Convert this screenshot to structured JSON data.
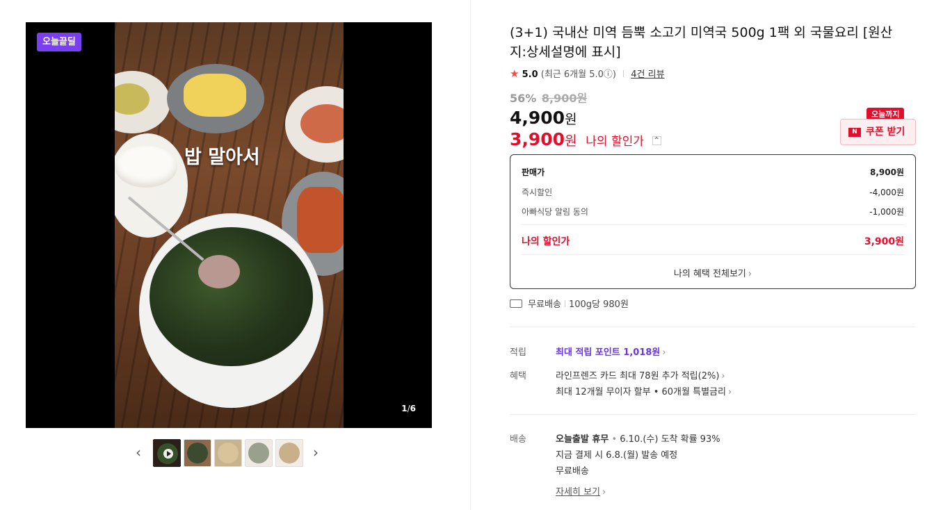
{
  "gallery": {
    "deal_badge": "오늘끝딜",
    "overlay_caption": "밥 말아서",
    "counter_current": "1",
    "counter_total": "6",
    "prev_arrow": "‹",
    "next_arrow": "›"
  },
  "product": {
    "title": "(3+1) 국내산 미역 듬뿍 소고기 미역국 500g 1팩 외 국물요리 [원산지:상세설명에 표시]",
    "rating": {
      "star": "★",
      "score": "5.0",
      "recent": "(최근 6개월 5.0ⓘ)",
      "reviews": "4건 리뷰"
    },
    "discount_rate": "56%",
    "original_price": "8,900원",
    "price": "4,900",
    "price_unit": "원",
    "my_price": "3,900",
    "my_price_unit": "원",
    "my_price_label": "나의 할인가",
    "my_price_caret": "^"
  },
  "coupon": {
    "tag": "오늘까지",
    "icon_text": "N",
    "label": "쿠폰 받기"
  },
  "breakdown": {
    "rows": [
      {
        "label": "판매가",
        "value": "8,900원"
      },
      {
        "label": "즉시할인",
        "value": "-4,000원"
      },
      {
        "label": "아빠식당 알림 동의",
        "value": "-1,000원"
      }
    ],
    "my_label": "나의 할인가",
    "my_value": "3,900원",
    "all_benefits": "나의 혜택 전체보기"
  },
  "shipping_summary": {
    "free": "무료배송",
    "unit_price": "100g당 980원"
  },
  "points": {
    "label": "적립",
    "value": "최대 적립 포인트 1,018원"
  },
  "benefits": {
    "label": "혜택",
    "line1": "라인프렌즈 카드 최대 78원 추가 적립(2%)",
    "line2": "최대 12개월 무이자 할부 • 60개월 특별금리"
  },
  "delivery": {
    "label": "배송",
    "status": "오늘출발 휴무",
    "dot": "•",
    "arrival": "6.10.(수) 도착 확률 93%",
    "ship_note": "지금 결제 시 6.8.(월) 발송 예정",
    "fee": "무료배송",
    "details": "자세히 보기"
  },
  "colors": {
    "accent_red": "#e0102d",
    "deal_purple": "#7b3ff2",
    "point_purple": "#6a35e6"
  }
}
